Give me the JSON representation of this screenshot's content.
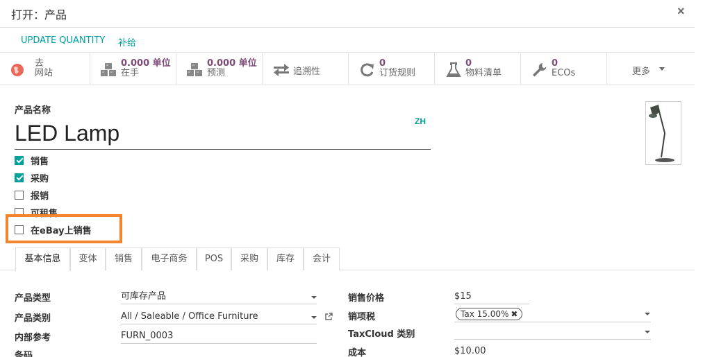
{
  "dialog": {
    "title": "打开：产品",
    "close": "×"
  },
  "actions": {
    "update_quantity": "UPDATE QUANTITY",
    "replenish": "补给"
  },
  "stats": {
    "website": {
      "line1": "去",
      "line2": "网站"
    },
    "on_hand": {
      "value": "0.000 单位",
      "label": "在手"
    },
    "forecast": {
      "value": "0.000 单位",
      "label": "预测"
    },
    "traceability": {
      "label": "追溯性"
    },
    "reorder": {
      "value": "0",
      "label": "订货规则"
    },
    "bom": {
      "value": "0",
      "label": "物料清单"
    },
    "ecos": {
      "value": "0",
      "label": "ECOs"
    },
    "more": "更多"
  },
  "product": {
    "name_label": "产品名称",
    "name": "LED Lamp",
    "lang": "ZH"
  },
  "checkboxes": [
    {
      "label": "销售",
      "checked": true
    },
    {
      "label": "采购",
      "checked": true
    },
    {
      "label": "报销",
      "checked": false
    },
    {
      "label": "可租售",
      "checked": false
    },
    {
      "label": "在eBay上销售",
      "checked": false
    }
  ],
  "tabs": [
    "基本信息",
    "变体",
    "销售",
    "电子商务",
    "POS",
    "采购",
    "库存",
    "会计"
  ],
  "fields_left": {
    "type_label": "产品类型",
    "type_value": "可库存产品",
    "category_label": "产品类别",
    "category_value": "All / Saleable / Office Furniture",
    "ref_label": "内部参考",
    "ref_value": "FURN_0003",
    "barcode_label": "条码"
  },
  "fields_right": {
    "price_label": "销售价格",
    "price_value": "$15",
    "tax_label": "销项税",
    "tax_value": "Tax 15.00%",
    "taxcloud_label": "TaxCloud 类别",
    "cost_label": "成本",
    "cost_value": "$10.00"
  },
  "colors": {
    "accent": "#00a09d",
    "stat_value": "#7c4b78",
    "highlight": "#f5852c"
  }
}
